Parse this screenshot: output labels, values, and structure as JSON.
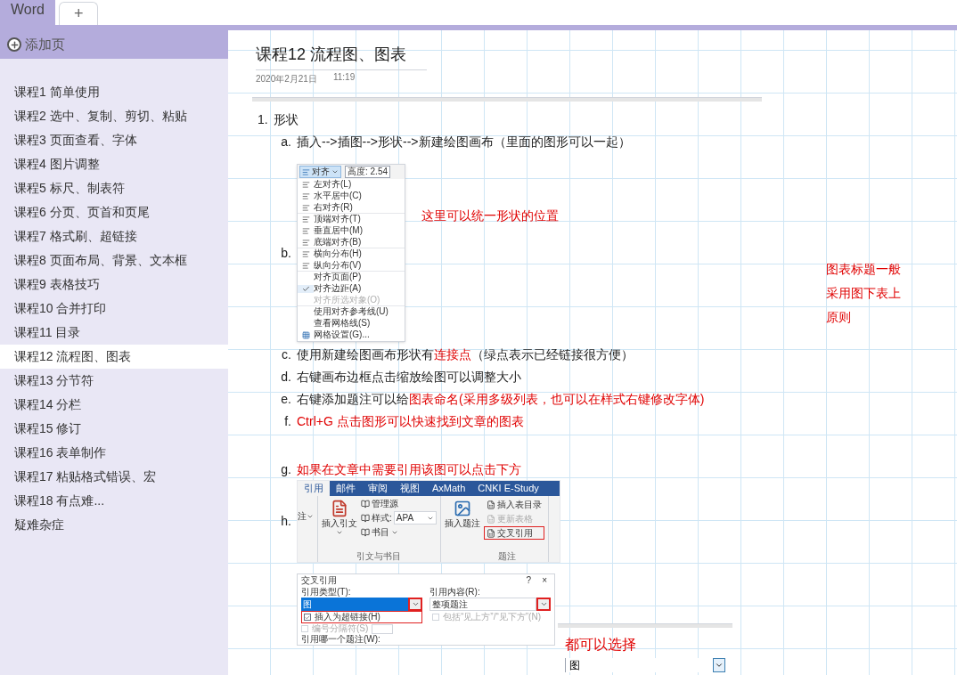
{
  "tabs": [
    {
      "label": "Word",
      "kind": "section",
      "selected": true
    },
    {
      "label": "+",
      "kind": "add",
      "selected": false
    }
  ],
  "sidebar": {
    "add_page": "添加页",
    "pages": [
      {
        "title": "课程1 简单使用",
        "selected": false
      },
      {
        "title": "课程2 选中、复制、剪切、粘贴",
        "selected": false
      },
      {
        "title": "课程3 页面查看、字体",
        "selected": false
      },
      {
        "title": "课程4 图片调整",
        "selected": false
      },
      {
        "title": "课程5 标尺、制表符",
        "selected": false
      },
      {
        "title": "课程6 分页、页首和页尾",
        "selected": false
      },
      {
        "title": "课程7 格式刷、超链接",
        "selected": false
      },
      {
        "title": "课程8 页面布局、背景、文本框",
        "selected": false
      },
      {
        "title": "课程9 表格技巧",
        "selected": false
      },
      {
        "title": "课程10 合并打印",
        "selected": false
      },
      {
        "title": "课程11 目录",
        "selected": false
      },
      {
        "title": "课程12 流程图、图表",
        "selected": true
      },
      {
        "title": "课程13 分节符",
        "selected": false
      },
      {
        "title": "课程14 分栏",
        "selected": false
      },
      {
        "title": "课程15 修订",
        "selected": false
      },
      {
        "title": "课程16 表单制作",
        "selected": false
      },
      {
        "title": "课程17 粘贴格式错误、宏",
        "selected": false
      },
      {
        "title": "课程18 有点难...",
        "selected": false
      },
      {
        "title": "疑难杂症",
        "selected": false
      }
    ]
  },
  "page": {
    "title": "课程12 流程图、图表",
    "date": "2020年2月21日",
    "time": "11:19",
    "heading_number": "1.",
    "heading": "形状",
    "items": [
      {
        "kind": "text",
        "letter": "a.",
        "parts": [
          {
            "text": "插入-->插图-->形状-->新建绘图画布（里面的图形可以一起）",
            "red": false
          }
        ]
      },
      {
        "kind": "menu_image",
        "letter": "b.",
        "annotation": "这里可以统一形状的位置"
      },
      {
        "kind": "text",
        "letter": "c.",
        "parts": [
          {
            "text": "使用新建绘图画布形状有",
            "red": false
          },
          {
            "text": "连接点",
            "red": true
          },
          {
            "text": "（绿点表示已经链接很方便）",
            "red": false
          }
        ]
      },
      {
        "kind": "text",
        "letter": "d.",
        "parts": [
          {
            "text": "右键画布边框点击缩放绘图可以调整大小",
            "red": false
          }
        ]
      },
      {
        "kind": "text",
        "letter": "e.",
        "parts": [
          {
            "text": "右键添加题注可以给",
            "red": false
          },
          {
            "text": "图表命名(采用多级列表，也可以在样式右键修改字体)",
            "red": true
          }
        ]
      },
      {
        "kind": "text",
        "letter": "f.",
        "parts": [
          {
            "text": "Ctrl+G 点击图形可以快速找到文章的图表",
            "red": true
          }
        ]
      },
      {
        "kind": "blank"
      },
      {
        "kind": "text",
        "letter": "g.",
        "parts": [
          {
            "text": "如果在文章中需要引用该图可以点击下方",
            "red": true
          }
        ]
      },
      {
        "kind": "ribbon_image",
        "letter": "h."
      },
      {
        "kind": "dialog_image"
      }
    ],
    "side_note": "图表标题一般采用图下表上原则",
    "small_note": {
      "text": "都可以选择",
      "dropdown_value": "图"
    }
  },
  "menu_image": {
    "button": "对齐",
    "field": "高度: 2.54",
    "items": [
      {
        "label": "左对齐(L)",
        "kind": "icon",
        "checked": false,
        "disabled": false,
        "separator_after": false
      },
      {
        "label": "水平居中(C)",
        "kind": "icon",
        "checked": false,
        "disabled": false,
        "separator_after": false
      },
      {
        "label": "右对齐(R)",
        "kind": "icon",
        "checked": false,
        "disabled": false,
        "separator_after": true
      },
      {
        "label": "顶端对齐(T)",
        "kind": "icon",
        "checked": false,
        "disabled": false,
        "separator_after": false
      },
      {
        "label": "垂直居中(M)",
        "kind": "icon",
        "checked": false,
        "disabled": false,
        "separator_after": false
      },
      {
        "label": "底端对齐(B)",
        "kind": "icon",
        "checked": false,
        "disabled": false,
        "separator_after": true
      },
      {
        "label": "横向分布(H)",
        "kind": "icon",
        "checked": false,
        "disabled": false,
        "separator_after": false
      },
      {
        "label": "纵向分布(V)",
        "kind": "icon",
        "checked": false,
        "disabled": false,
        "separator_after": true
      },
      {
        "label": "对齐页面(P)",
        "kind": "plain",
        "checked": false,
        "disabled": false,
        "separator_after": false
      },
      {
        "label": "对齐边距(A)",
        "kind": "plain",
        "checked": true,
        "disabled": false,
        "separator_after": false
      },
      {
        "label": "对齐所选对象(O)",
        "kind": "plain",
        "checked": false,
        "disabled": true,
        "separator_after": true
      },
      {
        "label": "使用对齐参考线(U)",
        "kind": "plain",
        "checked": false,
        "disabled": false,
        "separator_after": false
      },
      {
        "label": "查看网格线(S)",
        "kind": "plain",
        "checked": false,
        "disabled": false,
        "separator_after": false
      },
      {
        "label": "网格设置(G)...",
        "kind": "grid",
        "checked": false,
        "disabled": false,
        "separator_after": false
      }
    ]
  },
  "ribbon_image": {
    "tabs": [
      {
        "label": "引用",
        "selected": true
      },
      {
        "label": "邮件",
        "selected": false
      },
      {
        "label": "审阅",
        "selected": false
      },
      {
        "label": "视图",
        "selected": false
      },
      {
        "label": "AxMath",
        "selected": false
      },
      {
        "label": "CNKI E-Study",
        "selected": false
      }
    ],
    "partial_button": "注",
    "insert_citation": "插入引文",
    "manage_sources": "管理源",
    "style_label": "样式:",
    "style_value": "APA",
    "bibliography": "书目",
    "group1": "引文与书目",
    "insert_caption": "插入题注",
    "small_buttons": [
      {
        "label": "插入表目录",
        "disabled": false,
        "highlighted": false
      },
      {
        "label": "更新表格",
        "disabled": true,
        "highlighted": false
      },
      {
        "label": "交叉引用",
        "disabled": false,
        "highlighted": true
      }
    ],
    "group2": "题注"
  },
  "dialog_image": {
    "title": "交叉引用",
    "help": "?",
    "close": "×",
    "type_label": "引用类型(T):",
    "type_value": "图",
    "type_arrow_highlighted": true,
    "content_label": "引用内容(R):",
    "content_value": "整项题注",
    "content_arrow_highlighted": true,
    "checkboxes": [
      {
        "label": "插入为超链接(H)",
        "checked": true,
        "disabled": false,
        "highlighted": true
      },
      {
        "label": "包括“见上方”/“见下方”(N)",
        "checked": false,
        "disabled": true,
        "highlighted": false
      }
    ],
    "separator_label": "编号分隔符(S)",
    "which_label": "引用哪一个题注(W):"
  }
}
